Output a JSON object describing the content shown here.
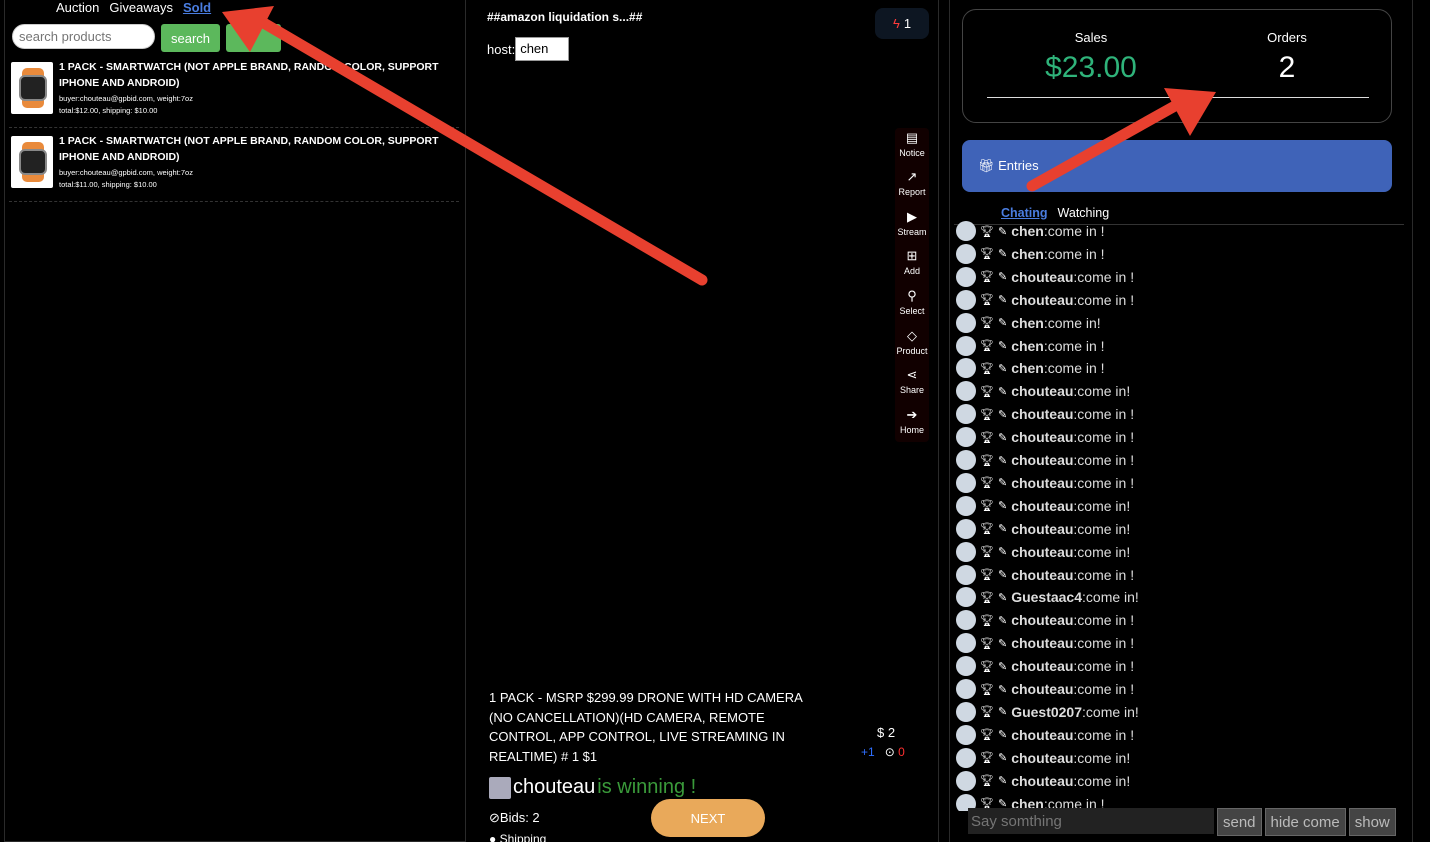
{
  "left": {
    "tabs": [
      "Auction",
      "Giveaways",
      "Sold"
    ],
    "active_tab": "Sold",
    "search_placeholder": "search products",
    "search_button": "search",
    "orders": [
      {
        "title": "1 PACK - SMARTWATCH (NOT APPLE BRAND, RANDOM COLOR, SUPPORT IPHONE AND ANDROID)",
        "buyer": "buyer:chouteau@gpbid.com, weight:7oz",
        "totals": "total:$12.00, shipping: $10.00"
      },
      {
        "title": "1 PACK - SMARTWATCH (NOT APPLE BRAND, RANDOM COLOR, SUPPORT IPHONE AND ANDROID)",
        "buyer": "buyer:chouteau@gpbid.com, weight:7oz",
        "totals": "total:$11.00, shipping: $10.00"
      }
    ]
  },
  "center": {
    "room_title": "##amazon liquidation s...##",
    "host_label": "host:",
    "host_value": "chen",
    "viewer_count": "1",
    "tools": [
      "Notice",
      "Report",
      "Stream",
      "Add",
      "Select",
      "Product",
      "Share",
      "Home"
    ],
    "product_title": "1 PACK - MSRP $299.99 DRONE WITH HD CAMERA (NO CANCELLATION)(HD CAMERA, REMOTE CONTROL, APP CONTROL, LIVE STREAMING IN REALTIME) # 1 $1",
    "price": "$ 2",
    "increment": "+1",
    "timer": "0",
    "winner_name": "chouteau",
    "winner_suffix": " is winning !",
    "bids": "Bids: 2",
    "shipping": "Shipping",
    "next_button": "NEXT"
  },
  "right": {
    "sales_label": "Sales",
    "sales_value": "$23.00",
    "orders_label": "Orders",
    "orders_value": "2",
    "entries_label": "Entries",
    "chat_tabs": [
      "Chating",
      "Watching"
    ],
    "messages": [
      {
        "name": "chen",
        "text": ":come in !"
      },
      {
        "name": "chen",
        "text": ":come in !"
      },
      {
        "name": "chouteau",
        "text": ":come in !"
      },
      {
        "name": "chouteau",
        "text": ":come in !"
      },
      {
        "name": "chen",
        "text": ":come in!"
      },
      {
        "name": "chen",
        "text": ":come in !"
      },
      {
        "name": "chen",
        "text": ":come in !"
      },
      {
        "name": "chouteau",
        "text": ":come in!"
      },
      {
        "name": "chouteau",
        "text": ":come in !"
      },
      {
        "name": "chouteau",
        "text": ":come in !"
      },
      {
        "name": "chouteau",
        "text": ":come in !"
      },
      {
        "name": "chouteau",
        "text": ":come in !"
      },
      {
        "name": "chouteau",
        "text": ":come in!"
      },
      {
        "name": "chouteau",
        "text": ":come in!"
      },
      {
        "name": "chouteau",
        "text": ":come in!"
      },
      {
        "name": "chouteau",
        "text": ":come in !"
      },
      {
        "name": "Guestaac4",
        "text": ":come in!"
      },
      {
        "name": "chouteau",
        "text": ":come in !"
      },
      {
        "name": "chouteau",
        "text": ":come in !"
      },
      {
        "name": "chouteau",
        "text": ":come in !"
      },
      {
        "name": "chouteau",
        "text": ":come in !"
      },
      {
        "name": "Guest0207",
        "text": ":come in!"
      },
      {
        "name": "chouteau",
        "text": ":come in !"
      },
      {
        "name": "chouteau",
        "text": ":come in!"
      },
      {
        "name": "chouteau",
        "text": ":come in!"
      },
      {
        "name": "chen",
        "text": ":come in !"
      }
    ],
    "say_placeholder": "Say somthing",
    "send_button": "send",
    "hide_button": "hide come",
    "show_button": "show"
  },
  "colors": {
    "accent_blue": "#4a7de0",
    "green": "#5cb85c",
    "sales_green": "#2fb37a",
    "entries_blue": "#3f63b8",
    "arrow_red": "#e8402f",
    "next_orange": "#e9a95a"
  }
}
